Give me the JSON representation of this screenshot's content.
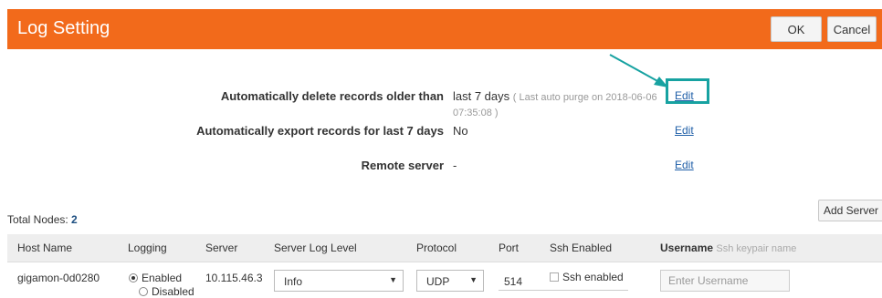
{
  "header": {
    "title": "Log Setting",
    "ok_label": "OK",
    "cancel_label": "Cancel",
    "accent": "#f26a1b"
  },
  "settings": [
    {
      "label": "Automatically delete records older than",
      "value": "last 7 days",
      "note": "( Last auto purge on 2018-06-06 07:35:08 )",
      "edit": "Edit"
    },
    {
      "label": "Automatically export records for last 7 days",
      "value": "No",
      "edit": "Edit"
    },
    {
      "label": "Remote server",
      "value": "-",
      "edit": "Edit"
    }
  ],
  "highlight_color": "#17a2a1",
  "nodes": {
    "total_label": "Total Nodes:",
    "total_count": "2",
    "add_server_label": "Add Server"
  },
  "table": {
    "headers": {
      "host": "Host Name",
      "logging": "Logging",
      "server": "Server",
      "level": "Server Log Level",
      "protocol": "Protocol",
      "port": "Port",
      "ssh": "Ssh Enabled",
      "username": "Username",
      "username_sub": "Ssh keypair name"
    },
    "rows": [
      {
        "host": "gigamon-0d0280",
        "logging_enabled": "Enabled",
        "logging_disabled": "Disabled",
        "server": "10.115.46.3",
        "level": "Info",
        "protocol": "UDP",
        "port": "514",
        "ssh": "Ssh enabled",
        "username_placeholder": "Enter Username"
      }
    ]
  }
}
